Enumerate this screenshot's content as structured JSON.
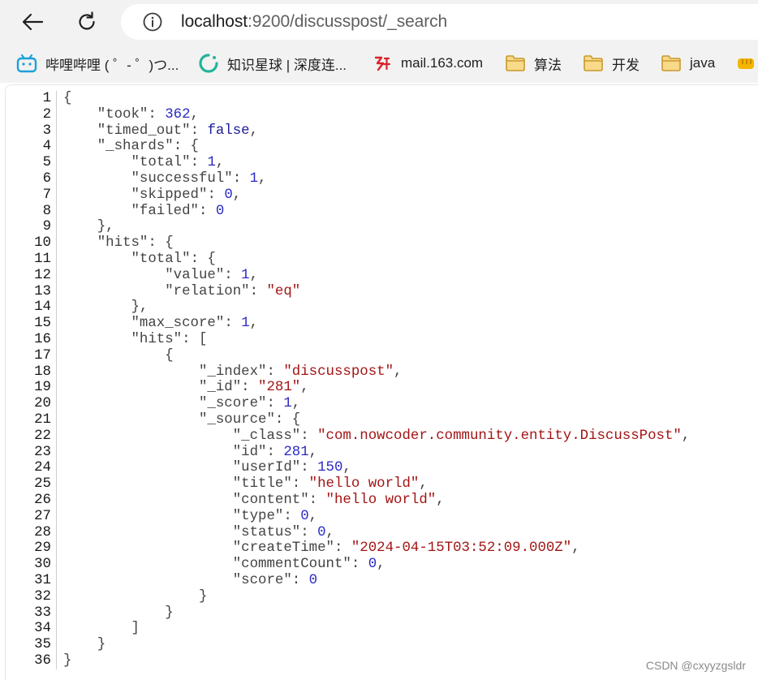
{
  "browser": {
    "url_host": "localhost",
    "url_rest": ":9200/discusspost/_search",
    "bookmarks": [
      {
        "label": "哔哩哔哩 ( ゜- ゜)つ...",
        "icon": "bilibili-icon"
      },
      {
        "label": "知识星球 | 深度连...",
        "icon": "zsxq-icon"
      },
      {
        "label": "mail.163.com",
        "icon": "netease-mail-icon"
      },
      {
        "label": "算法",
        "icon": "folder-icon"
      },
      {
        "label": "开发",
        "icon": "folder-icon"
      },
      {
        "label": "java",
        "icon": "folder-icon"
      }
    ]
  },
  "colors": {
    "string": "#a31515",
    "number": "#2a2ac4",
    "key": "#444444"
  },
  "code": {
    "lines": [
      {
        "indent": 0,
        "tokens": [
          [
            "punct",
            "{"
          ]
        ]
      },
      {
        "indent": 1,
        "tokens": [
          [
            "key",
            "\"took\""
          ],
          [
            "punct",
            ": "
          ],
          [
            "num",
            "362"
          ],
          [
            "punct",
            ","
          ]
        ]
      },
      {
        "indent": 1,
        "tokens": [
          [
            "key",
            "\"timed_out\""
          ],
          [
            "punct",
            ": "
          ],
          [
            "bool",
            "false"
          ],
          [
            "punct",
            ","
          ]
        ]
      },
      {
        "indent": 1,
        "tokens": [
          [
            "key",
            "\"_shards\""
          ],
          [
            "punct",
            ": {"
          ]
        ]
      },
      {
        "indent": 2,
        "tokens": [
          [
            "key",
            "\"total\""
          ],
          [
            "punct",
            ": "
          ],
          [
            "num",
            "1"
          ],
          [
            "punct",
            ","
          ]
        ]
      },
      {
        "indent": 2,
        "tokens": [
          [
            "key",
            "\"successful\""
          ],
          [
            "punct",
            ": "
          ],
          [
            "num",
            "1"
          ],
          [
            "punct",
            ","
          ]
        ]
      },
      {
        "indent": 2,
        "tokens": [
          [
            "key",
            "\"skipped\""
          ],
          [
            "punct",
            ": "
          ],
          [
            "num",
            "0"
          ],
          [
            "punct",
            ","
          ]
        ]
      },
      {
        "indent": 2,
        "tokens": [
          [
            "key",
            "\"failed\""
          ],
          [
            "punct",
            ": "
          ],
          [
            "num",
            "0"
          ]
        ]
      },
      {
        "indent": 1,
        "tokens": [
          [
            "punct",
            "},"
          ]
        ]
      },
      {
        "indent": 1,
        "tokens": [
          [
            "key",
            "\"hits\""
          ],
          [
            "punct",
            ": {"
          ]
        ]
      },
      {
        "indent": 2,
        "tokens": [
          [
            "key",
            "\"total\""
          ],
          [
            "punct",
            ": {"
          ]
        ]
      },
      {
        "indent": 3,
        "tokens": [
          [
            "key",
            "\"value\""
          ],
          [
            "punct",
            ": "
          ],
          [
            "num",
            "1"
          ],
          [
            "punct",
            ","
          ]
        ]
      },
      {
        "indent": 3,
        "tokens": [
          [
            "key",
            "\"relation\""
          ],
          [
            "punct",
            ": "
          ],
          [
            "str",
            "\"eq\""
          ]
        ]
      },
      {
        "indent": 2,
        "tokens": [
          [
            "punct",
            "},"
          ]
        ]
      },
      {
        "indent": 2,
        "tokens": [
          [
            "key",
            "\"max_score\""
          ],
          [
            "punct",
            ": "
          ],
          [
            "num",
            "1"
          ],
          [
            "punct",
            ","
          ]
        ]
      },
      {
        "indent": 2,
        "tokens": [
          [
            "key",
            "\"hits\""
          ],
          [
            "punct",
            ": ["
          ]
        ]
      },
      {
        "indent": 3,
        "tokens": [
          [
            "punct",
            "{"
          ]
        ]
      },
      {
        "indent": 4,
        "tokens": [
          [
            "key",
            "\"_index\""
          ],
          [
            "punct",
            ": "
          ],
          [
            "str",
            "\"discusspost\""
          ],
          [
            "punct",
            ","
          ]
        ]
      },
      {
        "indent": 4,
        "tokens": [
          [
            "key",
            "\"_id\""
          ],
          [
            "punct",
            ": "
          ],
          [
            "str",
            "\"281\""
          ],
          [
            "punct",
            ","
          ]
        ]
      },
      {
        "indent": 4,
        "tokens": [
          [
            "key",
            "\"_score\""
          ],
          [
            "punct",
            ": "
          ],
          [
            "num",
            "1"
          ],
          [
            "punct",
            ","
          ]
        ]
      },
      {
        "indent": 4,
        "tokens": [
          [
            "key",
            "\"_source\""
          ],
          [
            "punct",
            ": {"
          ]
        ]
      },
      {
        "indent": 5,
        "tokens": [
          [
            "key",
            "\"_class\""
          ],
          [
            "punct",
            ": "
          ],
          [
            "str",
            "\"com.nowcoder.community.entity.DiscussPost\""
          ],
          [
            "punct",
            ","
          ]
        ]
      },
      {
        "indent": 5,
        "tokens": [
          [
            "key",
            "\"id\""
          ],
          [
            "punct",
            ": "
          ],
          [
            "num",
            "281"
          ],
          [
            "punct",
            ","
          ]
        ]
      },
      {
        "indent": 5,
        "tokens": [
          [
            "key",
            "\"userId\""
          ],
          [
            "punct",
            ": "
          ],
          [
            "num",
            "150"
          ],
          [
            "punct",
            ","
          ]
        ]
      },
      {
        "indent": 5,
        "tokens": [
          [
            "key",
            "\"title\""
          ],
          [
            "punct",
            ": "
          ],
          [
            "str",
            "\"hello world\""
          ],
          [
            "punct",
            ","
          ]
        ]
      },
      {
        "indent": 5,
        "tokens": [
          [
            "key",
            "\"content\""
          ],
          [
            "punct",
            ": "
          ],
          [
            "str",
            "\"hello world\""
          ],
          [
            "punct",
            ","
          ]
        ]
      },
      {
        "indent": 5,
        "tokens": [
          [
            "key",
            "\"type\""
          ],
          [
            "punct",
            ": "
          ],
          [
            "num",
            "0"
          ],
          [
            "punct",
            ","
          ]
        ]
      },
      {
        "indent": 5,
        "tokens": [
          [
            "key",
            "\"status\""
          ],
          [
            "punct",
            ": "
          ],
          [
            "num",
            "0"
          ],
          [
            "punct",
            ","
          ]
        ]
      },
      {
        "indent": 5,
        "tokens": [
          [
            "key",
            "\"createTime\""
          ],
          [
            "punct",
            ": "
          ],
          [
            "str",
            "\"2024-04-15T03:52:09.000Z\""
          ],
          [
            "punct",
            ","
          ]
        ]
      },
      {
        "indent": 5,
        "tokens": [
          [
            "key",
            "\"commentCount\""
          ],
          [
            "punct",
            ": "
          ],
          [
            "num",
            "0"
          ],
          [
            "punct",
            ","
          ]
        ]
      },
      {
        "indent": 5,
        "tokens": [
          [
            "key",
            "\"score\""
          ],
          [
            "punct",
            ": "
          ],
          [
            "num",
            "0"
          ]
        ]
      },
      {
        "indent": 4,
        "tokens": [
          [
            "punct",
            "}"
          ]
        ]
      },
      {
        "indent": 3,
        "tokens": [
          [
            "punct",
            "}"
          ]
        ]
      },
      {
        "indent": 2,
        "tokens": [
          [
            "punct",
            "]"
          ]
        ]
      },
      {
        "indent": 1,
        "tokens": [
          [
            "punct",
            "}"
          ]
        ]
      },
      {
        "indent": 0,
        "tokens": [
          [
            "punct",
            "}"
          ]
        ]
      }
    ]
  },
  "watermark": "CSDN @cxyyzgsldr"
}
